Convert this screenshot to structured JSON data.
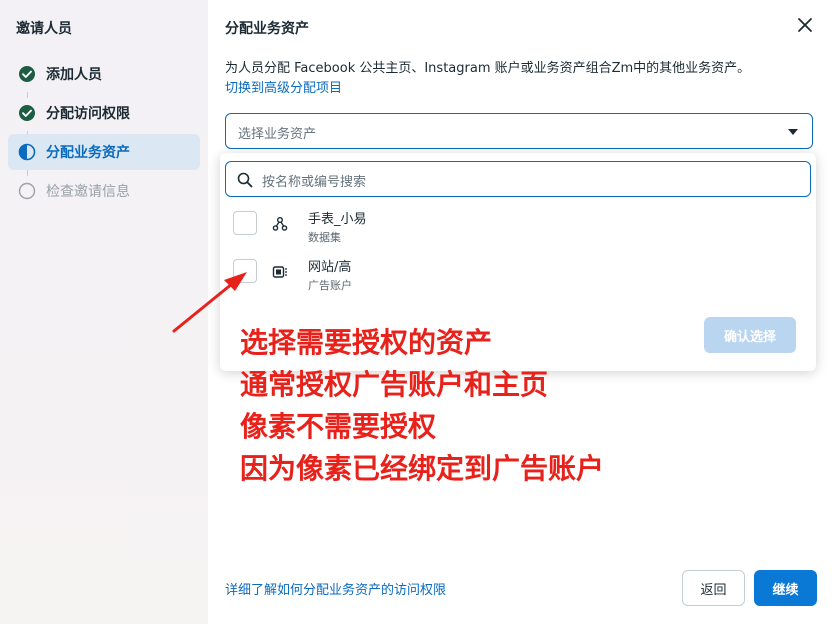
{
  "sidebar": {
    "title": "邀请人员",
    "steps": [
      {
        "label": "添加人员",
        "state": "done"
      },
      {
        "label": "分配访问权限",
        "state": "done"
      },
      {
        "label": "分配业务资产",
        "state": "active"
      },
      {
        "label": "检查邀请信息",
        "state": "pending"
      }
    ]
  },
  "dialog": {
    "title": "分配业务资产",
    "description": "为人员分配 Facebook 公共主页、Instagram 账户或业务资产组合Zm中的其他业务资产。",
    "switch_link": "切换到高级分配项目",
    "select_placeholder": "选择业务资产",
    "search_placeholder": "按名称或编号搜索",
    "items": [
      {
        "name": "手表_小易",
        "type": "数据集",
        "icon": "dataset-icon"
      },
      {
        "name": "网站/高",
        "type": "广告账户",
        "icon": "ad-account-icon"
      }
    ],
    "confirm_label": "确认选择",
    "learn_link": "详细了解如何分配业务资产的访问权限",
    "back_label": "返回",
    "continue_label": "继续"
  },
  "annotation": {
    "lines": [
      "选择需要授权的资产",
      "通常授权广告账户和主页",
      "像素不需要授权",
      "因为像素已经绑定到广告账户"
    ],
    "color": "#e8221b"
  },
  "colors": {
    "accent": "#0a6bbf",
    "primary_button": "#0a78d5",
    "done_check": "#1c5d44"
  }
}
